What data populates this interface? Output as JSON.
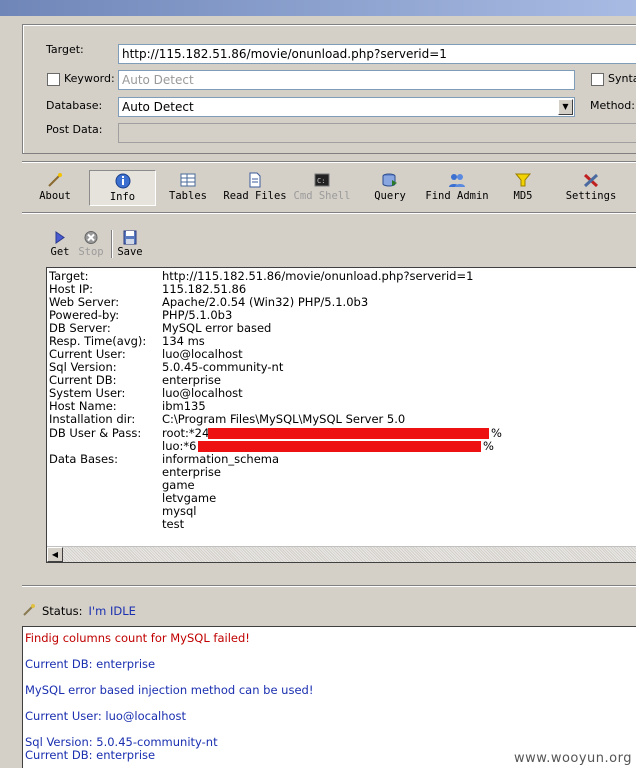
{
  "form": {
    "target_label": "Target:",
    "target_value": "http://115.182.51.86/movie/onunload.php?serverid=1",
    "keyword_label": "Keyword:",
    "keyword_placeholder": "Auto Detect",
    "syntax_label": "Synta",
    "database_label": "Database:",
    "database_value": "Auto Detect",
    "method_label": "Method:",
    "postdata_label": "Post Data:"
  },
  "toolbar": {
    "about": "About",
    "info": "Info",
    "tables": "Tables",
    "read_files": "Read Files",
    "cmd_shell": "Cmd Shell",
    "query": "Query",
    "find_admin": "Find Admin",
    "md5": "MD5",
    "settings": "Settings"
  },
  "subtoolbar": {
    "get": "Get",
    "stop": "Stop",
    "save": "Save"
  },
  "info": {
    "rows": [
      {
        "k": "Target:",
        "v": "http://115.182.51.86/movie/onunload.php?serverid=1"
      },
      {
        "k": "Host IP:",
        "v": "115.182.51.86"
      },
      {
        "k": "Web Server:",
        "v": "Apache/2.0.54 (Win32) PHP/5.1.0b3"
      },
      {
        "k": "Powered-by:",
        "v": "PHP/5.1.0b3"
      },
      {
        "k": "DB Server:",
        "v": "MySQL error based"
      },
      {
        "k": "Resp. Time(avg):",
        "v": "134 ms"
      },
      {
        "k": "Current User:",
        "v": "luo@localhost"
      },
      {
        "k": "Sql Version:",
        "v": "5.0.45-community-nt"
      },
      {
        "k": "Current DB:",
        "v": "enterprise"
      },
      {
        "k": "System User:",
        "v": "luo@localhost"
      },
      {
        "k": "Host Name:",
        "v": "ibm135"
      },
      {
        "k": "Installation dir:",
        "v": "C:\\Program Files\\MySQL\\MySQL Server 5.0"
      }
    ],
    "dbuser_label": "DB User & Pass:",
    "dbuser_1_prefix": "root:*24",
    "dbuser_1_suffix": "%",
    "dbuser_2_prefix": "luo:*6",
    "dbuser_2_suffix": "%",
    "databases_label": "Data Bases:",
    "databases": [
      "information_schema",
      "enterprise",
      "game",
      "letvgame",
      "mysql",
      "test"
    ]
  },
  "status": {
    "label": "Status:",
    "value": "I'm IDLE"
  },
  "log": [
    {
      "text": "Findig columns count for MySQL failed!",
      "type": "err"
    },
    {
      "text": "Current DB: enterprise",
      "type": "info"
    },
    {
      "text": "MySQL error based injection method can be used!",
      "type": "info"
    },
    {
      "text": "Current User: luo@localhost",
      "type": "info"
    },
    {
      "text": "Sql Version: 5.0.45-community-nt",
      "type": "info"
    },
    {
      "text": "Current DB: enterprise",
      "type": "info"
    }
  ],
  "watermark": "www.wooyun.org",
  "colors": {
    "window_bg": "#d4d0c8",
    "log_text": "#1a2fb0",
    "log_error": "#c00000",
    "redaction": "#ee1111"
  }
}
